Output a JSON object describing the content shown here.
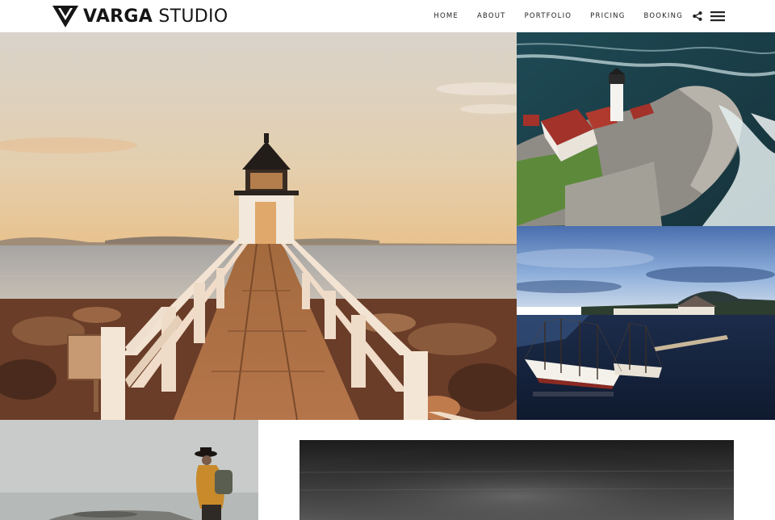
{
  "brand": {
    "name_bold": "VARGA",
    "name_light": "STUDIO"
  },
  "nav": {
    "items": [
      {
        "label": "HOME"
      },
      {
        "label": "ABOUT"
      },
      {
        "label": "PORTFOLIO"
      },
      {
        "label": "PRICING"
      },
      {
        "label": "BOOKING"
      }
    ],
    "icons": [
      "share-icon",
      "hamburger-menu-icon"
    ]
  },
  "gallery": {
    "photos": [
      {
        "subject": "lighthouse-boardwalk-sunset"
      },
      {
        "subject": "aerial-lighthouse-rocky-coast"
      },
      {
        "subject": "tall-ships-harbor-dusk"
      },
      {
        "subject": "traveler-with-backpack"
      },
      {
        "subject": "long-exposure-seascape-monochrome"
      }
    ]
  },
  "colors": {
    "header_bg": "#ffffff",
    "text": "#222222"
  }
}
